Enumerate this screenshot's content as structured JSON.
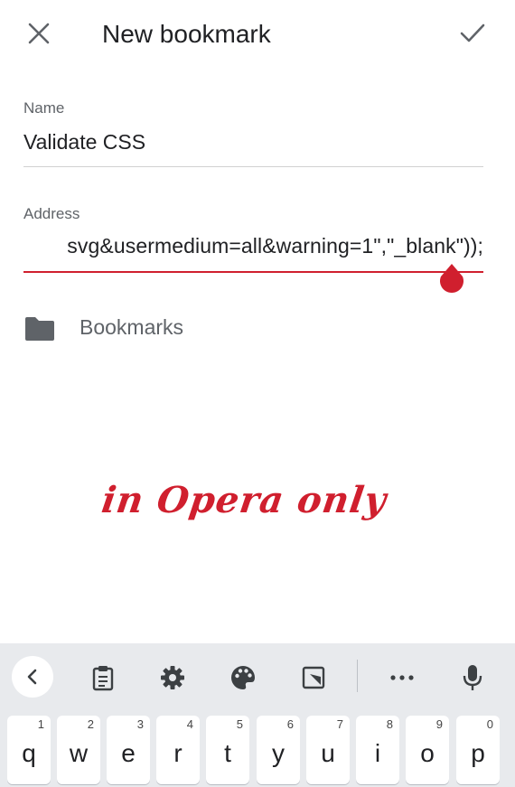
{
  "header": {
    "close_icon": "close-icon",
    "title": "New bookmark",
    "save_icon": "check-icon"
  },
  "form": {
    "name_label": "Name",
    "name_value": "Validate CSS",
    "address_label": "Address",
    "address_value": "svg&usermedium=all&warning=1\",\"_blank\"));"
  },
  "folder": {
    "icon": "folder-icon",
    "label": "Bookmarks"
  },
  "annotation": "in Opera only",
  "keyboard": {
    "toolbar_icons": [
      "chevron-left-icon",
      "clipboard-icon",
      "gear-icon",
      "palette-icon",
      "resize-icon",
      "more-icon",
      "mic-icon"
    ],
    "keys": [
      {
        "label": "q",
        "hint": "1"
      },
      {
        "label": "w",
        "hint": "2"
      },
      {
        "label": "e",
        "hint": "3"
      },
      {
        "label": "r",
        "hint": "4"
      },
      {
        "label": "t",
        "hint": "5"
      },
      {
        "label": "y",
        "hint": "6"
      },
      {
        "label": "u",
        "hint": "7"
      },
      {
        "label": "i",
        "hint": "8"
      },
      {
        "label": "o",
        "hint": "9"
      },
      {
        "label": "p",
        "hint": "0"
      }
    ]
  },
  "colors": {
    "accent": "#d01f2e",
    "keyboard_bg": "#e8eaed",
    "icon_gray": "#5f6368"
  }
}
